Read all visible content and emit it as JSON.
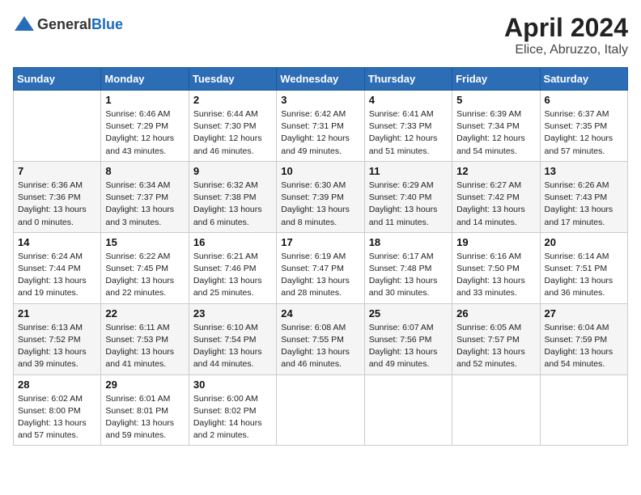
{
  "header": {
    "logo_general": "General",
    "logo_blue": "Blue",
    "month": "April 2024",
    "location": "Elice, Abruzzo, Italy"
  },
  "weekdays": [
    "Sunday",
    "Monday",
    "Tuesday",
    "Wednesday",
    "Thursday",
    "Friday",
    "Saturday"
  ],
  "weeks": [
    [
      {
        "day": null
      },
      {
        "day": "1",
        "sunrise": "Sunrise: 6:46 AM",
        "sunset": "Sunset: 7:29 PM",
        "daylight": "Daylight: 12 hours and 43 minutes."
      },
      {
        "day": "2",
        "sunrise": "Sunrise: 6:44 AM",
        "sunset": "Sunset: 7:30 PM",
        "daylight": "Daylight: 12 hours and 46 minutes."
      },
      {
        "day": "3",
        "sunrise": "Sunrise: 6:42 AM",
        "sunset": "Sunset: 7:31 PM",
        "daylight": "Daylight: 12 hours and 49 minutes."
      },
      {
        "day": "4",
        "sunrise": "Sunrise: 6:41 AM",
        "sunset": "Sunset: 7:33 PM",
        "daylight": "Daylight: 12 hours and 51 minutes."
      },
      {
        "day": "5",
        "sunrise": "Sunrise: 6:39 AM",
        "sunset": "Sunset: 7:34 PM",
        "daylight": "Daylight: 12 hours and 54 minutes."
      },
      {
        "day": "6",
        "sunrise": "Sunrise: 6:37 AM",
        "sunset": "Sunset: 7:35 PM",
        "daylight": "Daylight: 12 hours and 57 minutes."
      }
    ],
    [
      {
        "day": "7",
        "sunrise": "Sunrise: 6:36 AM",
        "sunset": "Sunset: 7:36 PM",
        "daylight": "Daylight: 13 hours and 0 minutes."
      },
      {
        "day": "8",
        "sunrise": "Sunrise: 6:34 AM",
        "sunset": "Sunset: 7:37 PM",
        "daylight": "Daylight: 13 hours and 3 minutes."
      },
      {
        "day": "9",
        "sunrise": "Sunrise: 6:32 AM",
        "sunset": "Sunset: 7:38 PM",
        "daylight": "Daylight: 13 hours and 6 minutes."
      },
      {
        "day": "10",
        "sunrise": "Sunrise: 6:30 AM",
        "sunset": "Sunset: 7:39 PM",
        "daylight": "Daylight: 13 hours and 8 minutes."
      },
      {
        "day": "11",
        "sunrise": "Sunrise: 6:29 AM",
        "sunset": "Sunset: 7:40 PM",
        "daylight": "Daylight: 13 hours and 11 minutes."
      },
      {
        "day": "12",
        "sunrise": "Sunrise: 6:27 AM",
        "sunset": "Sunset: 7:42 PM",
        "daylight": "Daylight: 13 hours and 14 minutes."
      },
      {
        "day": "13",
        "sunrise": "Sunrise: 6:26 AM",
        "sunset": "Sunset: 7:43 PM",
        "daylight": "Daylight: 13 hours and 17 minutes."
      }
    ],
    [
      {
        "day": "14",
        "sunrise": "Sunrise: 6:24 AM",
        "sunset": "Sunset: 7:44 PM",
        "daylight": "Daylight: 13 hours and 19 minutes."
      },
      {
        "day": "15",
        "sunrise": "Sunrise: 6:22 AM",
        "sunset": "Sunset: 7:45 PM",
        "daylight": "Daylight: 13 hours and 22 minutes."
      },
      {
        "day": "16",
        "sunrise": "Sunrise: 6:21 AM",
        "sunset": "Sunset: 7:46 PM",
        "daylight": "Daylight: 13 hours and 25 minutes."
      },
      {
        "day": "17",
        "sunrise": "Sunrise: 6:19 AM",
        "sunset": "Sunset: 7:47 PM",
        "daylight": "Daylight: 13 hours and 28 minutes."
      },
      {
        "day": "18",
        "sunrise": "Sunrise: 6:17 AM",
        "sunset": "Sunset: 7:48 PM",
        "daylight": "Daylight: 13 hours and 30 minutes."
      },
      {
        "day": "19",
        "sunrise": "Sunrise: 6:16 AM",
        "sunset": "Sunset: 7:50 PM",
        "daylight": "Daylight: 13 hours and 33 minutes."
      },
      {
        "day": "20",
        "sunrise": "Sunrise: 6:14 AM",
        "sunset": "Sunset: 7:51 PM",
        "daylight": "Daylight: 13 hours and 36 minutes."
      }
    ],
    [
      {
        "day": "21",
        "sunrise": "Sunrise: 6:13 AM",
        "sunset": "Sunset: 7:52 PM",
        "daylight": "Daylight: 13 hours and 39 minutes."
      },
      {
        "day": "22",
        "sunrise": "Sunrise: 6:11 AM",
        "sunset": "Sunset: 7:53 PM",
        "daylight": "Daylight: 13 hours and 41 minutes."
      },
      {
        "day": "23",
        "sunrise": "Sunrise: 6:10 AM",
        "sunset": "Sunset: 7:54 PM",
        "daylight": "Daylight: 13 hours and 44 minutes."
      },
      {
        "day": "24",
        "sunrise": "Sunrise: 6:08 AM",
        "sunset": "Sunset: 7:55 PM",
        "daylight": "Daylight: 13 hours and 46 minutes."
      },
      {
        "day": "25",
        "sunrise": "Sunrise: 6:07 AM",
        "sunset": "Sunset: 7:56 PM",
        "daylight": "Daylight: 13 hours and 49 minutes."
      },
      {
        "day": "26",
        "sunrise": "Sunrise: 6:05 AM",
        "sunset": "Sunset: 7:57 PM",
        "daylight": "Daylight: 13 hours and 52 minutes."
      },
      {
        "day": "27",
        "sunrise": "Sunrise: 6:04 AM",
        "sunset": "Sunset: 7:59 PM",
        "daylight": "Daylight: 13 hours and 54 minutes."
      }
    ],
    [
      {
        "day": "28",
        "sunrise": "Sunrise: 6:02 AM",
        "sunset": "Sunset: 8:00 PM",
        "daylight": "Daylight: 13 hours and 57 minutes."
      },
      {
        "day": "29",
        "sunrise": "Sunrise: 6:01 AM",
        "sunset": "Sunset: 8:01 PM",
        "daylight": "Daylight: 13 hours and 59 minutes."
      },
      {
        "day": "30",
        "sunrise": "Sunrise: 6:00 AM",
        "sunset": "Sunset: 8:02 PM",
        "daylight": "Daylight: 14 hours and 2 minutes."
      },
      {
        "day": null
      },
      {
        "day": null
      },
      {
        "day": null
      },
      {
        "day": null
      }
    ]
  ]
}
